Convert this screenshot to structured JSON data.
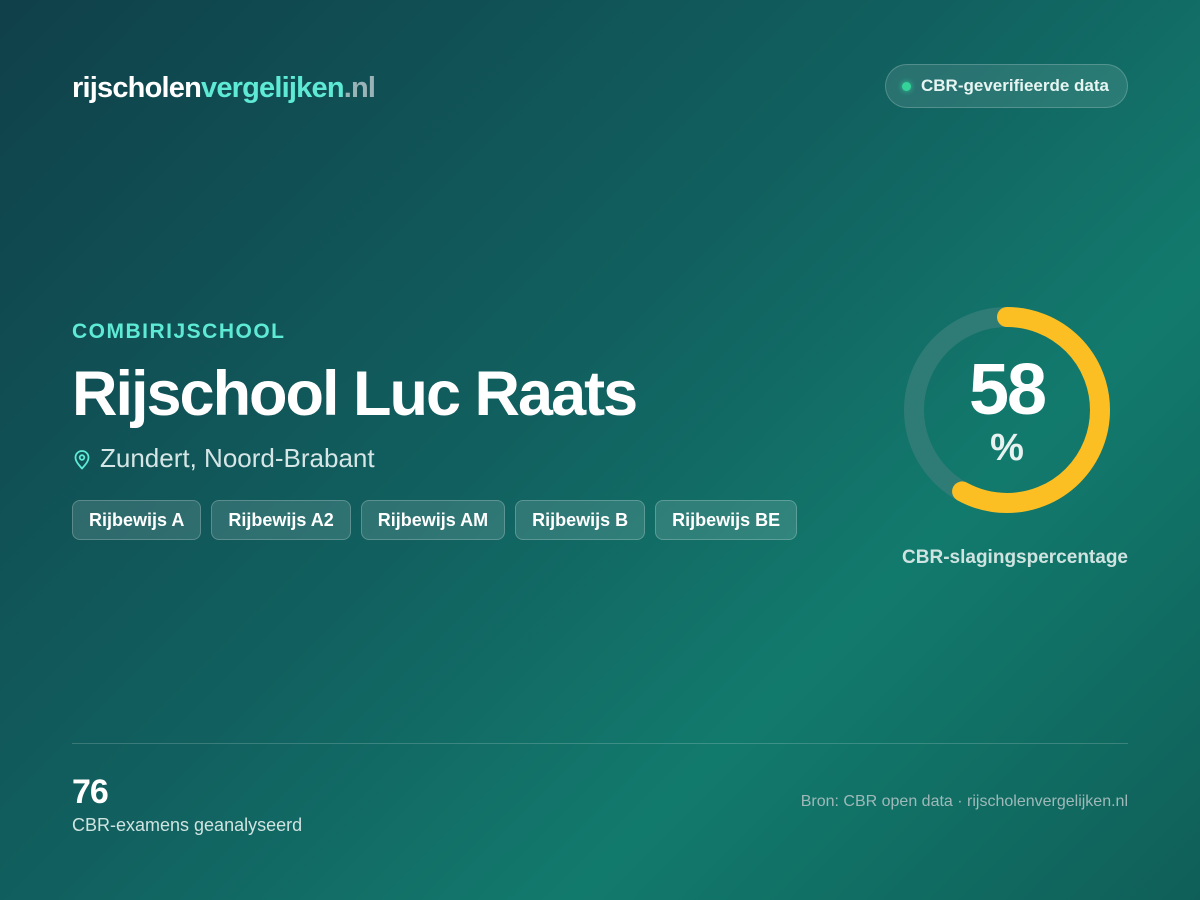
{
  "header": {
    "logo": {
      "part1": "rijscholen",
      "part2": "vergelijken",
      "part3": ".nl"
    },
    "verified_badge": "CBR-geverifieerde data"
  },
  "school": {
    "category": "COMBIRIJSCHOOL",
    "name": "Rijschool Luc Raats",
    "location": "Zundert, Noord-Brabant",
    "location_icon": "map-pin-icon",
    "licenses": [
      "Rijbewijs A",
      "Rijbewijs A2",
      "Rijbewijs AM",
      "Rijbewijs B",
      "Rijbewijs BE"
    ]
  },
  "pass_rate": {
    "value": 58,
    "value_text": "58",
    "unit": "%",
    "label": "CBR-slagingspercentage"
  },
  "stats": {
    "exams_count": "76",
    "exams_label": "CBR-examens geanalyseerd"
  },
  "footer": {
    "source": "Bron: CBR open data · rijscholenvergelijken.nl"
  },
  "colors": {
    "accent": "#5eead4",
    "gauge_fill": "#fbbf24",
    "gauge_track": "#2f7c77",
    "status_dot": "#34d399"
  }
}
